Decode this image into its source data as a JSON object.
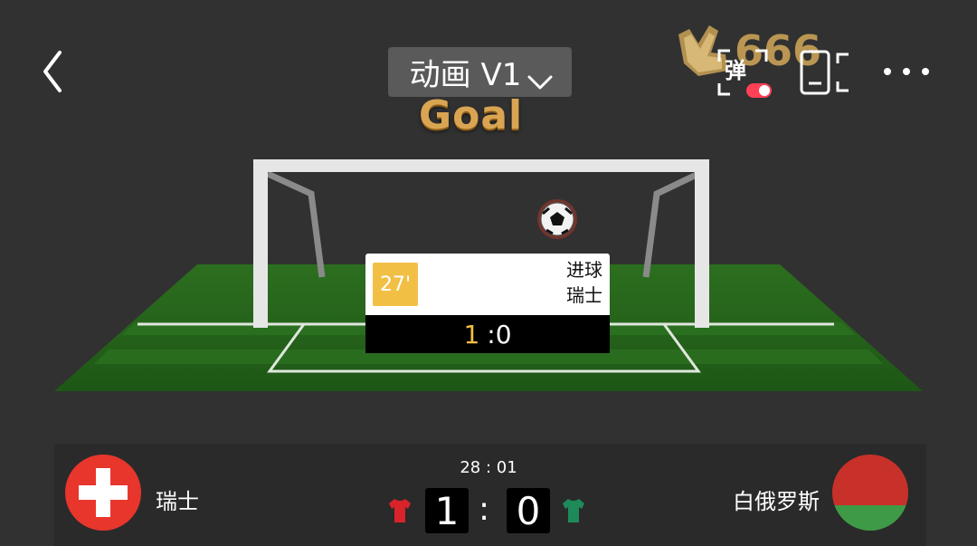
{
  "header": {
    "version_label": "动画 V1",
    "danmu_label": "弹",
    "logo_text": "666"
  },
  "animation": {
    "banner": "Goal",
    "event": {
      "minute": "27'",
      "type": "进球",
      "team": "瑞士",
      "score_home": "1",
      "score_away": ":0"
    }
  },
  "match": {
    "clock": "28 : 01",
    "home": {
      "name": "瑞士",
      "score": "1",
      "kit_color": "#d8232a"
    },
    "away": {
      "name": "白俄罗斯",
      "score": "0",
      "kit_color": "#1e8a5a"
    },
    "separator": ":"
  },
  "colors": {
    "accent": "#f2bf45",
    "background": "#313131",
    "toggle": "#ff4055"
  }
}
